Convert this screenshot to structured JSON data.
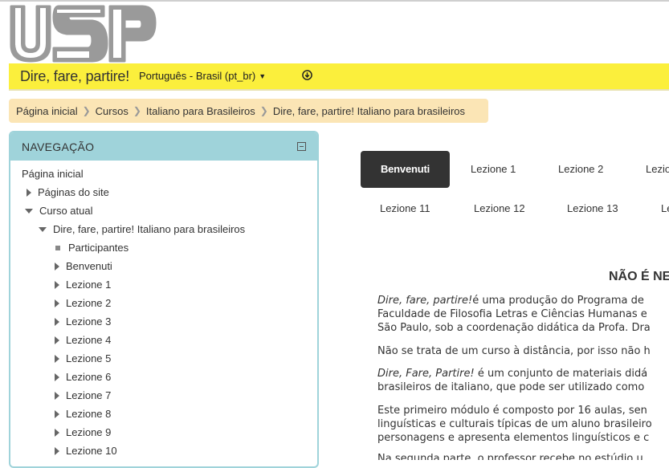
{
  "header": {
    "site_name": "Dire, fare, partire!",
    "language": "Português - Brasil (pt_br)",
    "logo_alt": "USP"
  },
  "colors": {
    "yellow_bar": "#fbef3c",
    "breadcrumb_bg": "#fbe5b5",
    "nav_header": "#9fd3da",
    "active_tab": "#333333"
  },
  "breadcrumb": [
    "Página inicial",
    "Cursos",
    "Italiano para Brasileiros",
    "Dire, fare, partire! Italiano para brasileiros"
  ],
  "navigation": {
    "title": "NAVEGAÇÃO",
    "items": [
      {
        "label": "Página inicial",
        "icon": "none"
      },
      {
        "label": "Páginas do site",
        "icon": "triangle-right"
      },
      {
        "label": "Curso atual",
        "icon": "triangle-down"
      },
      {
        "label": "Dire, fare, partire! Italiano para brasileiros",
        "icon": "triangle-down"
      },
      {
        "label": "Participantes",
        "icon": "square"
      },
      {
        "label": "Benvenuti",
        "icon": "triangle-right"
      },
      {
        "label": "Lezione 1",
        "icon": "triangle-right"
      },
      {
        "label": "Lezione 2",
        "icon": "triangle-right"
      },
      {
        "label": "Lezione 3",
        "icon": "triangle-right"
      },
      {
        "label": "Lezione 4",
        "icon": "triangle-right"
      },
      {
        "label": "Lezione 5",
        "icon": "triangle-right"
      },
      {
        "label": "Lezione 6",
        "icon": "triangle-right"
      },
      {
        "label": "Lezione 7",
        "icon": "triangle-right"
      },
      {
        "label": "Lezione 8",
        "icon": "triangle-right"
      },
      {
        "label": "Lezione 9",
        "icon": "triangle-right"
      },
      {
        "label": "Lezione 10",
        "icon": "triangle-right"
      }
    ]
  },
  "tabs": {
    "row1": [
      "Benvenuti",
      "Lezione 1",
      "Lezione 2",
      "Lezio"
    ],
    "row2": [
      "Lezione 11",
      "Lezione 12",
      "Lezione 13",
      "Le"
    ],
    "active": "Benvenuti"
  },
  "content": {
    "heading": "NÃO É NE",
    "p1_italic": "Dire, fare, partire!",
    "p1_line1_rest": "é uma produção do Programa de",
    "p1_line2": "Faculdade de Filosofia Letras e Ciências Humanas e",
    "p1_line3": "São Paulo, sob a coordenação didática da Profa. Dra",
    "p2_line1": "Não se trata de um curso à distância, por isso não h",
    "p3_italic": "Dire, Fare, Partire!",
    "p3_line1_rest": " é um conjunto de materiais didá",
    "p3_line2": "brasileiros de italiano, que pode ser utilizado como",
    "p4_line1": "Este primeiro módulo é composto por 16 aulas, sen",
    "p4_line2": "linguísticas e culturais típicas de um aluno brasileiro",
    "p4_line3": "personagens e apresenta elementos linguísticos e c",
    "p5_line1": "Na segunda parte, o professor recebe no estúdio u"
  }
}
